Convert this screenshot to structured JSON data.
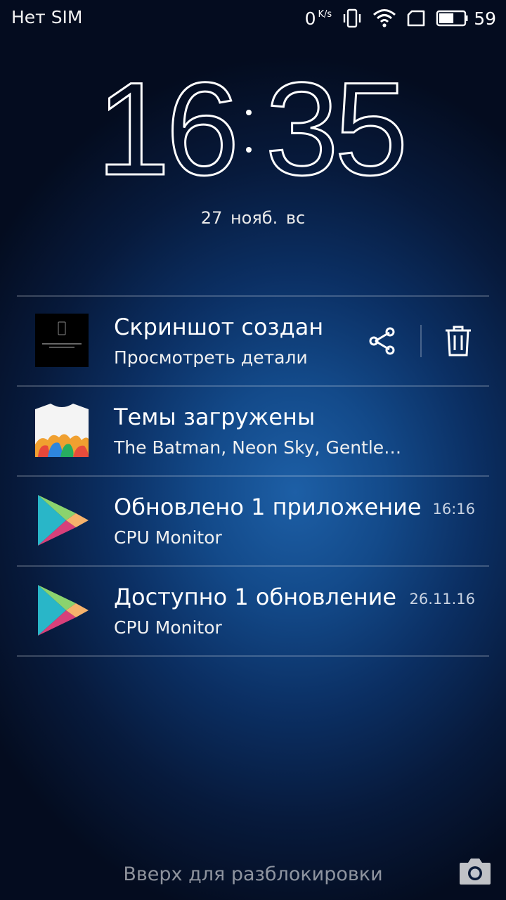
{
  "status_bar": {
    "carrier": "Нет SIM",
    "net_speed": "0",
    "net_unit": "K/s",
    "battery_percent": "59"
  },
  "lockscreen": {
    "time": "16:35",
    "time_hours": "16",
    "time_minutes": "35",
    "date": "27 нояб. вс"
  },
  "notifications": [
    {
      "title": "Скриншот создан",
      "subtitle": "Просмотреть детали",
      "icon": "screenshot-thumbnail",
      "actions": [
        "share-icon",
        "trash-icon"
      ]
    },
    {
      "title": "Темы загружены",
      "subtitle": "The Batman, Neon Sky, Gentlem…",
      "icon": "themes-shirt-icon"
    },
    {
      "title": "Обновлено 1 приложение",
      "subtitle": "CPU Monitor",
      "time": "16:16",
      "icon": "play-store-icon"
    },
    {
      "title": "Доступно 1 обновление",
      "subtitle": "CPU Monitor",
      "time": "26.11.16",
      "icon": "play-store-icon"
    }
  ],
  "unlock_hint": "Вверх для разблокировки",
  "colors": {
    "background_center": "#1d5fa6",
    "background_edge": "#040c1f",
    "divider": "#ffffff38"
  }
}
